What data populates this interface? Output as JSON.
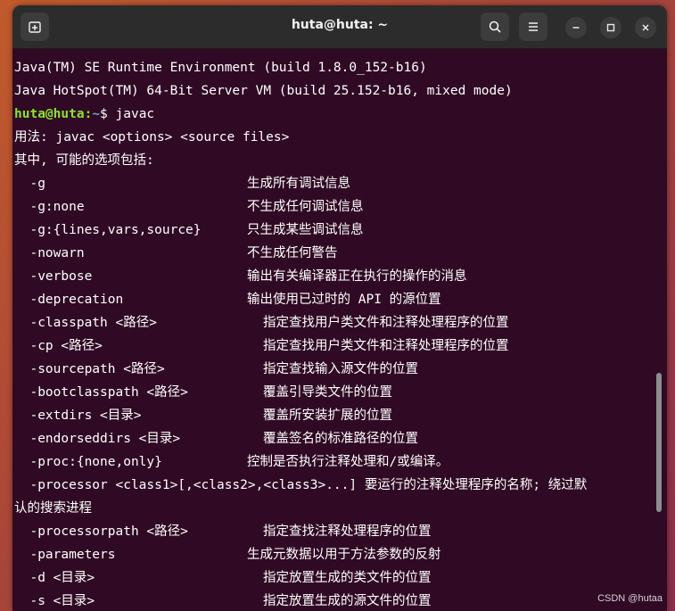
{
  "window": {
    "title": "huta@huta: ~"
  },
  "terminal": {
    "lines": [
      {
        "text": "Java(TM) SE Runtime Environment (build 1.8.0_152-b16)"
      },
      {
        "text": "Java HotSpot(TM) 64-Bit Server VM (build 25.152-b16, mixed mode)"
      },
      {
        "prompt_user": "huta@huta",
        "prompt_sep": ":",
        "prompt_path": "~",
        "prompt_end": "$ ",
        "command": "javac"
      },
      {
        "text": "用法: javac <options> <source files>"
      },
      {
        "text": "其中, 可能的选项包括:"
      },
      {
        "opt": "  -g",
        "desc": "生成所有调试信息",
        "indent": "a"
      },
      {
        "opt": "  -g:none",
        "desc": "不生成任何调试信息",
        "indent": "a"
      },
      {
        "opt": "  -g:{lines,vars,source}",
        "desc": "只生成某些调试信息",
        "indent": "a"
      },
      {
        "opt": "  -nowarn",
        "desc": "不生成任何警告",
        "indent": "a"
      },
      {
        "opt": "  -verbose",
        "desc": "输出有关编译器正在执行的操作的消息",
        "indent": "a"
      },
      {
        "opt": "  -deprecation",
        "desc": "输出使用已过时的 API 的源位置",
        "indent": "a"
      },
      {
        "opt": "  -classpath <路径>",
        "desc": "指定查找用户类文件和注释处理程序的位置",
        "indent": "b"
      },
      {
        "opt": "  -cp <路径>",
        "desc": "指定查找用户类文件和注释处理程序的位置",
        "indent": "b"
      },
      {
        "opt": "  -sourcepath <路径>",
        "desc": "指定查找输入源文件的位置",
        "indent": "b"
      },
      {
        "opt": "  -bootclasspath <路径>",
        "desc": "覆盖引导类文件的位置",
        "indent": "b"
      },
      {
        "opt": "  -extdirs <目录>",
        "desc": "覆盖所安装扩展的位置",
        "indent": "b"
      },
      {
        "opt": "  -endorseddirs <目录>",
        "desc": "覆盖签名的标准路径的位置",
        "indent": "b"
      },
      {
        "opt": "  -proc:{none,only}",
        "desc": "控制是否执行注释处理和/或编译。",
        "indent": "a"
      },
      {
        "text": "  -processor <class1>[,<class2>,<class3>...] 要运行的注释处理程序的名称; 绕过默"
      },
      {
        "text": "认的搜索进程"
      },
      {
        "opt": "  -processorpath <路径>",
        "desc": "指定查找注释处理程序的位置",
        "indent": "b"
      },
      {
        "opt": "  -parameters",
        "desc": "生成元数据以用于方法参数的反射",
        "indent": "a"
      },
      {
        "opt": "  -d <目录>",
        "desc": "指定放置生成的类文件的位置",
        "indent": "b"
      },
      {
        "opt": "  -s <目录>",
        "desc": "指定放置生成的源文件的位置",
        "indent": "b"
      }
    ]
  },
  "watermark": "CSDN @hutaa",
  "icons": {
    "new_tab": "new-tab-icon",
    "search": "search-icon",
    "menu": "hamburger-menu-icon",
    "minimize": "minimize-icon",
    "maximize": "maximize-icon",
    "close": "close-icon"
  }
}
